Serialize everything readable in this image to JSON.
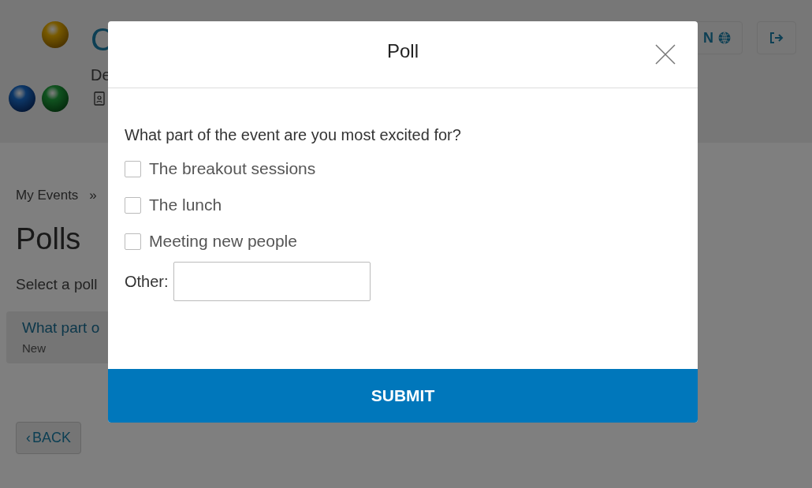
{
  "header": {
    "title": "C",
    "subtitle": "De",
    "language_button": "N"
  },
  "breadcrumb": {
    "items": [
      "My Events"
    ],
    "separator": "»"
  },
  "page": {
    "title": "Polls",
    "intro": "Select a poll",
    "polls": [
      {
        "title": "What part o",
        "status": "New"
      }
    ],
    "back": {
      "arrow": "‹",
      "label": "BACK"
    }
  },
  "dialog": {
    "title": "Poll",
    "question": "What part of the event are you most excited for?",
    "options": [
      {
        "label": "The breakout sessions",
        "checked": false
      },
      {
        "label": "The lunch",
        "checked": false
      },
      {
        "label": "Meeting new people",
        "checked": false
      }
    ],
    "other": {
      "label": "Other:"
    },
    "submit": "SUBMIT"
  }
}
